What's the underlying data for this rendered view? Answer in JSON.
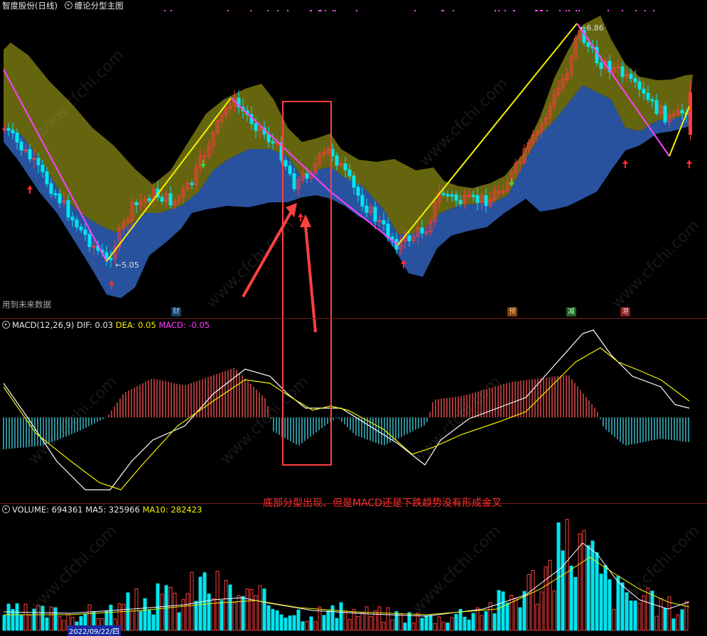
{
  "header": {
    "stock_name": "智度股份(日线)",
    "indicator_name": "缠论分型主图"
  },
  "future_data_note": "用到未来数据",
  "markers": {
    "cai": "财",
    "yu": "预",
    "jian": "减",
    "gang": "港"
  },
  "macd": {
    "title": "MACD(12,26,9)",
    "dif_label": "DIF: 0.03",
    "dea_label": "DEA: 0.05",
    "macd_label": "MACD: -0.05"
  },
  "volume": {
    "title": "VOLUME: 694361",
    "ma5_label": "MA5: 325966",
    "ma10_label": "MA10: 282423"
  },
  "annotation": "底部分型出现、但是MACD还是下跌趋势没有形成金叉",
  "watermark": "www.cfchi.com",
  "x_axis": [
    "2022/09/22/四"
  ],
  "chart_data": {
    "type": "line",
    "stroke_points": [
      {
        "label": "5.05",
        "value": 5.05
      },
      {
        "label": "6.86",
        "value": 6.86
      }
    ],
    "colors": {
      "up": "#ff3c3c",
      "down": "#00e6f0",
      "band_upper": "#6b6a10",
      "band_lower": "#2a56a6",
      "stroke_up": "#f4f000",
      "stroke_down": "#ff40ff"
    }
  }
}
